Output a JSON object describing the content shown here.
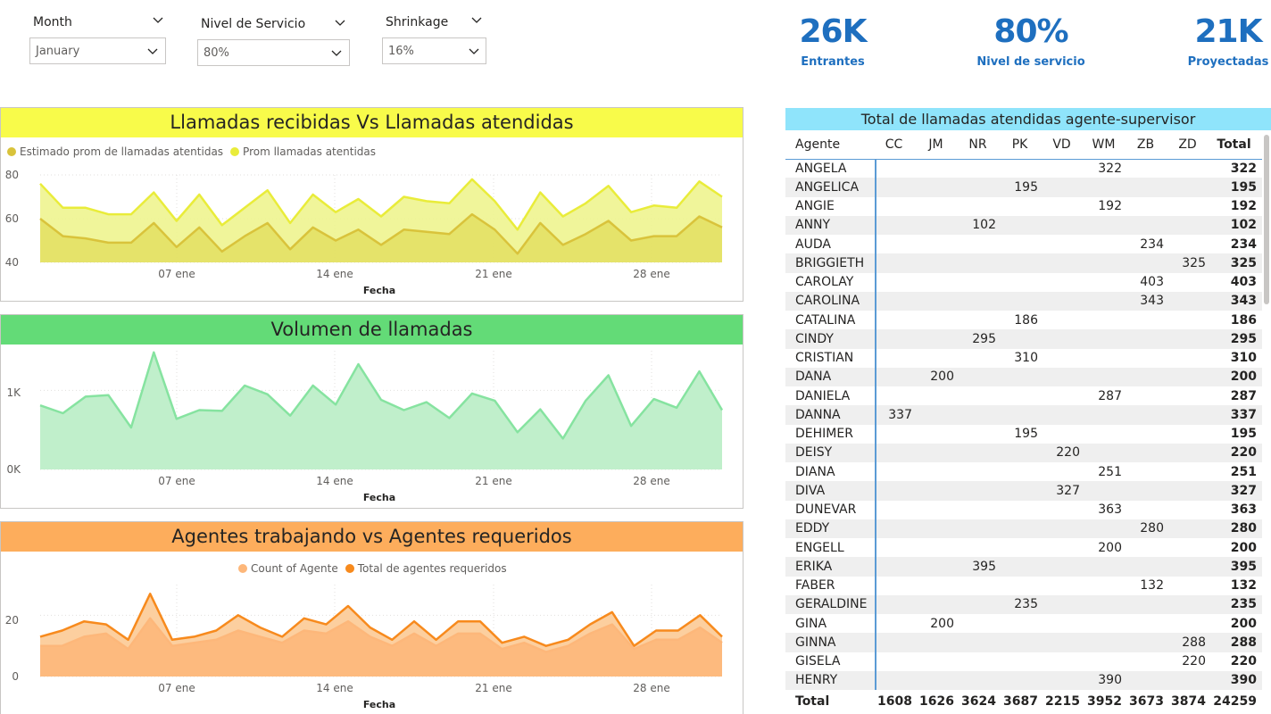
{
  "slicers": [
    {
      "title": "Month",
      "value": "January"
    },
    {
      "title": "Nivel de Servicio",
      "value": "80%"
    },
    {
      "title": "Shrinkage",
      "value": "16%"
    }
  ],
  "kpis": [
    {
      "value": "26K",
      "label": "Entrantes"
    },
    {
      "value": "80%",
      "label": "Nivel de servicio"
    },
    {
      "value": "21K",
      "label": "Proyectadas"
    }
  ],
  "colors": {
    "kpi": "#1e6fbf",
    "yellow_header": "#f8fb4a",
    "green_header": "#63db77",
    "orange_header": "#fdad5c",
    "table_header": "#8fe4fb"
  },
  "charts": {
    "llamadas": {
      "title": "Llamadas recibidas Vs Llamadas atendidas",
      "legend": [
        "Estimado prom de llamadas atentidas",
        "Prom llamadas atentidas"
      ],
      "xlabel": "Fecha",
      "yticks": [
        "40",
        "60",
        "80"
      ],
      "xticks": [
        "07 ene",
        "14 ene",
        "21 ene",
        "28 ene"
      ]
    },
    "volumen": {
      "title": "Volumen de llamadas",
      "xlabel": "Fecha",
      "yticks": [
        "0K",
        "1K"
      ],
      "xticks": [
        "07 ene",
        "14 ene",
        "21 ene",
        "28 ene"
      ]
    },
    "agentes": {
      "title": "Agentes trabajando vs Agentes requeridos",
      "legend": [
        "Count of Agente",
        "Total de agentes requeridos"
      ],
      "xlabel": "Fecha",
      "yticks": [
        "0",
        "20"
      ],
      "xticks": [
        "07 ene",
        "14 ene",
        "21 ene",
        "28 ene"
      ]
    }
  },
  "chart_data": [
    {
      "type": "area",
      "title": "Llamadas recibidas Vs Llamadas atendidas",
      "xlabel": "Fecha",
      "x_start": "2024-01-01",
      "x_end": "2024-01-31",
      "ylim": [
        40,
        80
      ],
      "series": [
        {
          "name": "Prom llamadas atentidas",
          "color": "#e9ec3a",
          "values": [
            76,
            65,
            65,
            62,
            62,
            72,
            59,
            71,
            57,
            65,
            73,
            58,
            71,
            63,
            69,
            61,
            70,
            68,
            67,
            78,
            68,
            55,
            72,
            61,
            67,
            75,
            63,
            66,
            65,
            77,
            70
          ]
        },
        {
          "name": "Estimado prom de llamadas atentidas",
          "color": "#d9c33b",
          "values": [
            60,
            52,
            51,
            49,
            49,
            58,
            47,
            56,
            45,
            52,
            58,
            46,
            56,
            50,
            55,
            48,
            55,
            54,
            53,
            62,
            55,
            44,
            58,
            48,
            53,
            59,
            50,
            52,
            52,
            61,
            56
          ]
        }
      ]
    },
    {
      "type": "area",
      "title": "Volumen de llamadas",
      "xlabel": "Fecha",
      "x_start": "2024-01-01",
      "x_end": "2024-01-31",
      "ylim": [
        0,
        1500
      ],
      "series": [
        {
          "name": "Volumen",
          "color": "#86e3a0",
          "values": [
            810,
            710,
            920,
            940,
            530,
            1480,
            640,
            750,
            740,
            1060,
            950,
            680,
            1060,
            820,
            1330,
            880,
            750,
            850,
            650,
            960,
            870,
            470,
            760,
            390,
            870,
            1190,
            550,
            890,
            780,
            1240,
            750
          ]
        }
      ]
    },
    {
      "type": "area",
      "title": "Agentes trabajando vs Agentes requeridos",
      "xlabel": "Fecha",
      "x_start": "2024-01-01",
      "x_end": "2024-01-31",
      "ylim": [
        0,
        30
      ],
      "series": [
        {
          "name": "Total de agentes requeridos",
          "color": "#f78a1d",
          "values": [
            13,
            15,
            18,
            17,
            12,
            27,
            12,
            13,
            15,
            20,
            16,
            13,
            19,
            17,
            23,
            16,
            12,
            18,
            12,
            18,
            18,
            11,
            13,
            10,
            12,
            17,
            21,
            10,
            15,
            15,
            20,
            13
          ]
        },
        {
          "name": "Count of Agente",
          "color": "#fdb77a",
          "values": [
            10,
            10,
            13,
            14,
            9,
            19,
            10,
            11,
            12,
            15,
            13,
            11,
            15,
            14,
            18,
            13,
            10,
            14,
            10,
            14,
            14,
            9,
            11,
            8,
            10,
            14,
            17,
            9,
            12,
            12,
            16,
            11
          ]
        }
      ]
    }
  ],
  "table": {
    "title": "Total de llamadas atendidas agente-supervisor",
    "headers": [
      "Agente",
      "CC",
      "JM",
      "NR",
      "PK",
      "VD",
      "WM",
      "ZB",
      "ZD",
      "Total"
    ],
    "rows": [
      [
        "ANGELA",
        "",
        "",
        "",
        "",
        "",
        "322",
        "",
        "",
        "322"
      ],
      [
        "ANGELICA",
        "",
        "",
        "",
        "195",
        "",
        "",
        "",
        "",
        "195"
      ],
      [
        "ANGIE",
        "",
        "",
        "",
        "",
        "",
        "192",
        "",
        "",
        "192"
      ],
      [
        "ANNY",
        "",
        "",
        "102",
        "",
        "",
        "",
        "",
        "",
        "102"
      ],
      [
        "AUDA",
        "",
        "",
        "",
        "",
        "",
        "",
        "234",
        "",
        "234"
      ],
      [
        "BRIGGIETH",
        "",
        "",
        "",
        "",
        "",
        "",
        "",
        "325",
        "325"
      ],
      [
        "CAROLAY",
        "",
        "",
        "",
        "",
        "",
        "",
        "403",
        "",
        "403"
      ],
      [
        "CAROLINA",
        "",
        "",
        "",
        "",
        "",
        "",
        "343",
        "",
        "343"
      ],
      [
        "CATALINA",
        "",
        "",
        "",
        "186",
        "",
        "",
        "",
        "",
        "186"
      ],
      [
        "CINDY",
        "",
        "",
        "295",
        "",
        "",
        "",
        "",
        "",
        "295"
      ],
      [
        "CRISTIAN",
        "",
        "",
        "",
        "310",
        "",
        "",
        "",
        "",
        "310"
      ],
      [
        "DANA",
        "",
        "200",
        "",
        "",
        "",
        "",
        "",
        "",
        "200"
      ],
      [
        "DANIELA",
        "",
        "",
        "",
        "",
        "",
        "287",
        "",
        "",
        "287"
      ],
      [
        "DANNA",
        "337",
        "",
        "",
        "",
        "",
        "",
        "",
        "",
        "337"
      ],
      [
        "DEHIMER",
        "",
        "",
        "",
        "195",
        "",
        "",
        "",
        "",
        "195"
      ],
      [
        "DEISY",
        "",
        "",
        "",
        "",
        "220",
        "",
        "",
        "",
        "220"
      ],
      [
        "DIANA",
        "",
        "",
        "",
        "",
        "",
        "251",
        "",
        "",
        "251"
      ],
      [
        "DIVA",
        "",
        "",
        "",
        "",
        "327",
        "",
        "",
        "",
        "327"
      ],
      [
        "DUNEVAR",
        "",
        "",
        "",
        "",
        "",
        "363",
        "",
        "",
        "363"
      ],
      [
        "EDDY",
        "",
        "",
        "",
        "",
        "",
        "",
        "280",
        "",
        "280"
      ],
      [
        "ENGELL",
        "",
        "",
        "",
        "",
        "",
        "200",
        "",
        "",
        "200"
      ],
      [
        "ERIKA",
        "",
        "",
        "395",
        "",
        "",
        "",
        "",
        "",
        "395"
      ],
      [
        "FABER",
        "",
        "",
        "",
        "",
        "",
        "",
        "132",
        "",
        "132"
      ],
      [
        "GERALDINE",
        "",
        "",
        "",
        "235",
        "",
        "",
        "",
        "",
        "235"
      ],
      [
        "GINA",
        "",
        "200",
        "",
        "",
        "",
        "",
        "",
        "",
        "200"
      ],
      [
        "GINNA",
        "",
        "",
        "",
        "",
        "",
        "",
        "",
        "288",
        "288"
      ],
      [
        "GISELA",
        "",
        "",
        "",
        "",
        "",
        "",
        "",
        "220",
        "220"
      ],
      [
        "HENRY",
        "",
        "",
        "",
        "",
        "",
        "390",
        "",
        "",
        "390"
      ]
    ],
    "footer": [
      "Total",
      "1608",
      "1626",
      "3624",
      "3687",
      "2215",
      "3952",
      "3673",
      "3874",
      "24259"
    ]
  }
}
